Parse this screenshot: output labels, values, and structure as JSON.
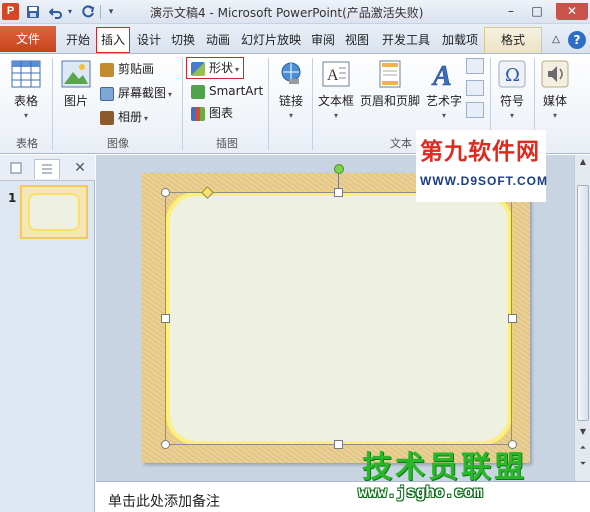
{
  "titlebar": {
    "app_icon": "P",
    "title": "演示文稿4 - Microsoft PowerPoint(产品激活失败)",
    "minimize": "–",
    "restore": "□",
    "close": "✕",
    "qat_save": "💾",
    "qat_undo": "↶",
    "qat_redo": "↻",
    "qat_more": "▾"
  },
  "tabs": {
    "file": "文件",
    "items": [
      "开始",
      "插入",
      "设计",
      "切换",
      "动画",
      "幻灯片放映",
      "审阅",
      "视图",
      "开发工具",
      "加载项",
      "格式"
    ],
    "minimize_ribbon": "△",
    "help": "?"
  },
  "ribbon": {
    "groups": {
      "table": "表格",
      "images": "图像",
      "illustrations": "插图",
      "text": "文本"
    },
    "buttons": {
      "table": "表格",
      "picture": "图片",
      "clipart": "剪贴画",
      "screenshot": "屏幕截图",
      "album": "相册",
      "shapes": "形状",
      "smartart": "SmartArt",
      "chart": "图表",
      "hyperlink": "链接",
      "textbox": "文本框",
      "header_footer": "页眉和页脚",
      "wordart": "艺术字",
      "symbol": "符号",
      "media": "媒体"
    }
  },
  "slide_panel": {
    "slide_number": "1",
    "close": "✕"
  },
  "notes": {
    "placeholder": "单击此处添加备注"
  },
  "watermarks": {
    "top_title": "第九软件网",
    "top_url": "WWW.D9SOFT.COM",
    "bottom_title": "技术员联盟",
    "bottom_url": "www.jsgho.com"
  }
}
